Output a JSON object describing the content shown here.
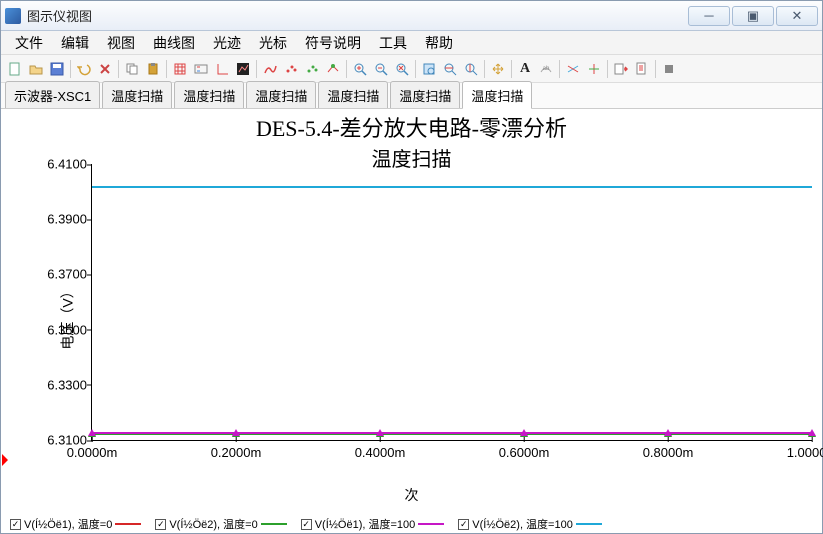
{
  "window": {
    "title": "图示仪视图"
  },
  "menu": [
    "文件",
    "编辑",
    "视图",
    "曲线图",
    "光迹",
    "光标",
    "符号说明",
    "工具",
    "帮助"
  ],
  "tabs": [
    "示波器-XSC1",
    "温度扫描",
    "温度扫描",
    "温度扫描",
    "温度扫描",
    "温度扫描",
    "温度扫描"
  ],
  "active_tab": 6,
  "chart_data": {
    "type": "line",
    "title": "DES-5.4-差分放大电路-零漂分析",
    "subtitle": "温度扫描",
    "xlabel": "次",
    "ylabel": "电压（V）",
    "xlim": [
      0.0,
      0.001
    ],
    "ylim": [
      6.31,
      6.41
    ],
    "xticks": [
      "0.0000m",
      "0.2000m",
      "0.4000m",
      "0.6000m",
      "0.8000m",
      "1.0000m"
    ],
    "yticks": [
      "6.3100",
      "6.3300",
      "6.3500",
      "6.3700",
      "6.3900",
      "6.4100"
    ],
    "series": [
      {
        "name": "V(Í½Öë1), 温度=0",
        "color": "#d62728",
        "y_const": 6.3125,
        "marker": "triangle"
      },
      {
        "name": "V(Í½Öë2), 温度=0",
        "color": "#2ca02c",
        "y_const": 6.3125,
        "marker": "triangle"
      },
      {
        "name": "V(Í½Öë1), 温度=100",
        "color": "#c617c6",
        "y_const": 6.313,
        "marker": "triangle"
      },
      {
        "name": "V(Í½Öë2), 温度=100",
        "color": "#1fa8d8",
        "y_const": 6.402,
        "marker": "none"
      }
    ]
  }
}
